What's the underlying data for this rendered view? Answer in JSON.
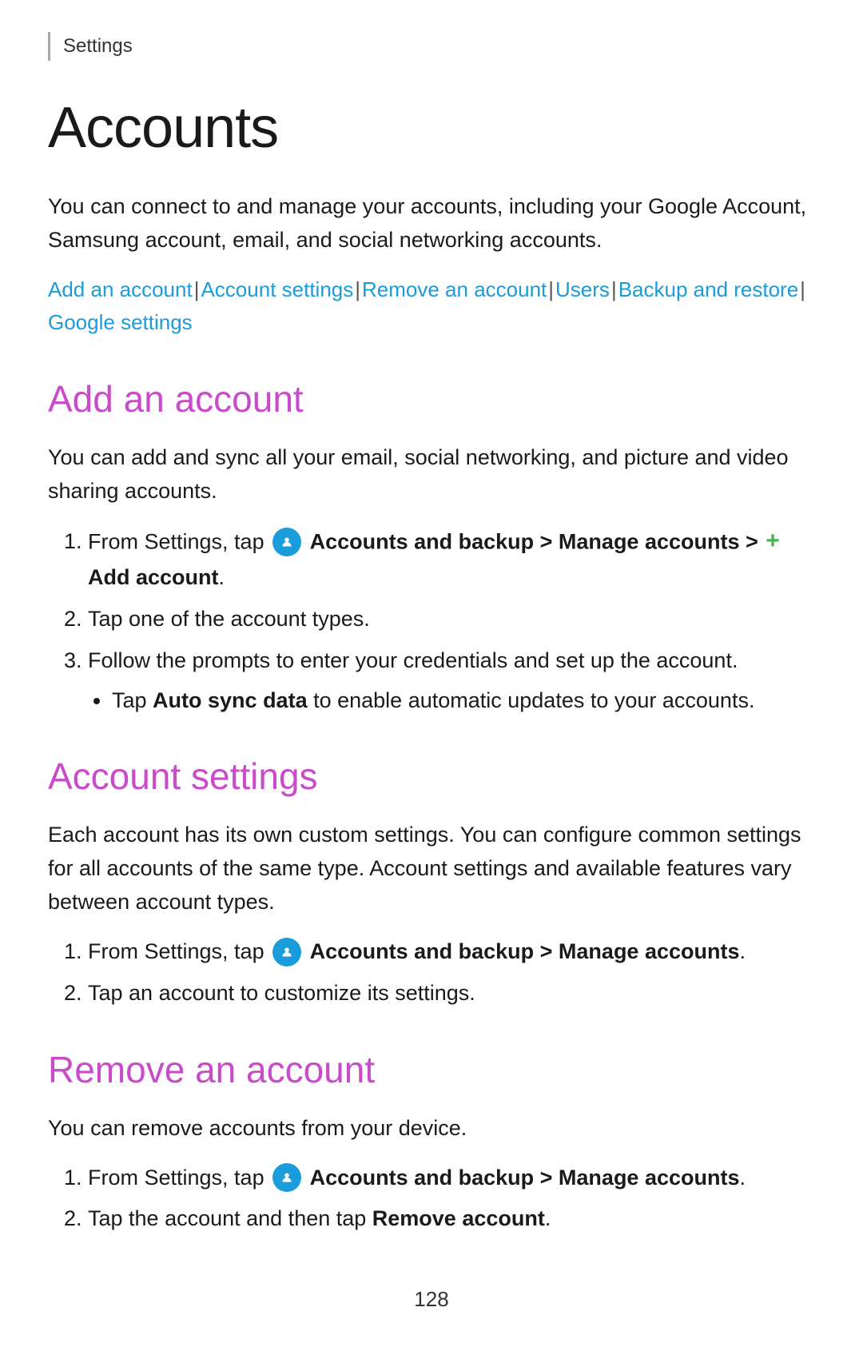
{
  "settings_label": "Settings",
  "page_title": "Accounts",
  "intro_text": "You can connect to and manage your accounts, including your Google Account, Samsung account, email, and social networking accounts.",
  "nav_links": [
    {
      "label": "Add an account",
      "id": "add-an-account"
    },
    {
      "label": "Account settings",
      "id": "account-settings"
    },
    {
      "label": "Remove an account",
      "id": "remove-an-account"
    },
    {
      "label": "Users",
      "id": "users"
    },
    {
      "label": "Backup and restore",
      "id": "backup-and-restore"
    },
    {
      "label": "Google settings",
      "id": "google-settings"
    }
  ],
  "sections": [
    {
      "id": "add-an-account",
      "title": "Add an account",
      "description": "You can add and sync all your email, social networking, and picture and video sharing accounts.",
      "steps": [
        {
          "type": "ordered",
          "text_parts": [
            {
              "text": "From Settings, tap ",
              "bold": false
            },
            {
              "text": "icon",
              "type": "icon"
            },
            {
              "text": " Accounts and backup > Manage accounts > ",
              "bold": true
            },
            {
              "text": "plus",
              "type": "plus"
            },
            {
              "text": " Add account",
              "bold": true
            },
            {
              "text": ".",
              "bold": false
            }
          ]
        },
        {
          "type": "ordered",
          "text": "Tap one of the account types."
        },
        {
          "type": "ordered",
          "text": "Follow the prompts to enter your credentials and set up the account.",
          "sub_items": [
            {
              "text_parts": [
                {
                  "text": "Tap ",
                  "bold": false
                },
                {
                  "text": "Auto sync data",
                  "bold": true
                },
                {
                  "text": " to enable automatic updates to your accounts.",
                  "bold": false
                }
              ]
            }
          ]
        }
      ]
    },
    {
      "id": "account-settings",
      "title": "Account settings",
      "description": "Each account has its own custom settings. You can configure common settings for all accounts of the same type. Account settings and available features vary between account types.",
      "steps": [
        {
          "type": "ordered",
          "text_parts": [
            {
              "text": "From Settings, tap ",
              "bold": false
            },
            {
              "text": "icon",
              "type": "icon"
            },
            {
              "text": " Accounts and backup > Manage accounts",
              "bold": true
            },
            {
              "text": ".",
              "bold": false
            }
          ]
        },
        {
          "type": "ordered",
          "text": "Tap an account to customize its settings."
        }
      ]
    },
    {
      "id": "remove-an-account",
      "title": "Remove an account",
      "description": "You can remove accounts from your device.",
      "steps": [
        {
          "type": "ordered",
          "text_parts": [
            {
              "text": "From Settings, tap ",
              "bold": false
            },
            {
              "text": "icon",
              "type": "icon"
            },
            {
              "text": " Accounts and backup > Manage accounts",
              "bold": true
            },
            {
              "text": ".",
              "bold": false
            }
          ]
        },
        {
          "type": "ordered",
          "text_parts": [
            {
              "text": "Tap the account and then tap ",
              "bold": false
            },
            {
              "text": "Remove account",
              "bold": true
            },
            {
              "text": ".",
              "bold": false
            }
          ]
        }
      ]
    }
  ],
  "page_number": "128"
}
